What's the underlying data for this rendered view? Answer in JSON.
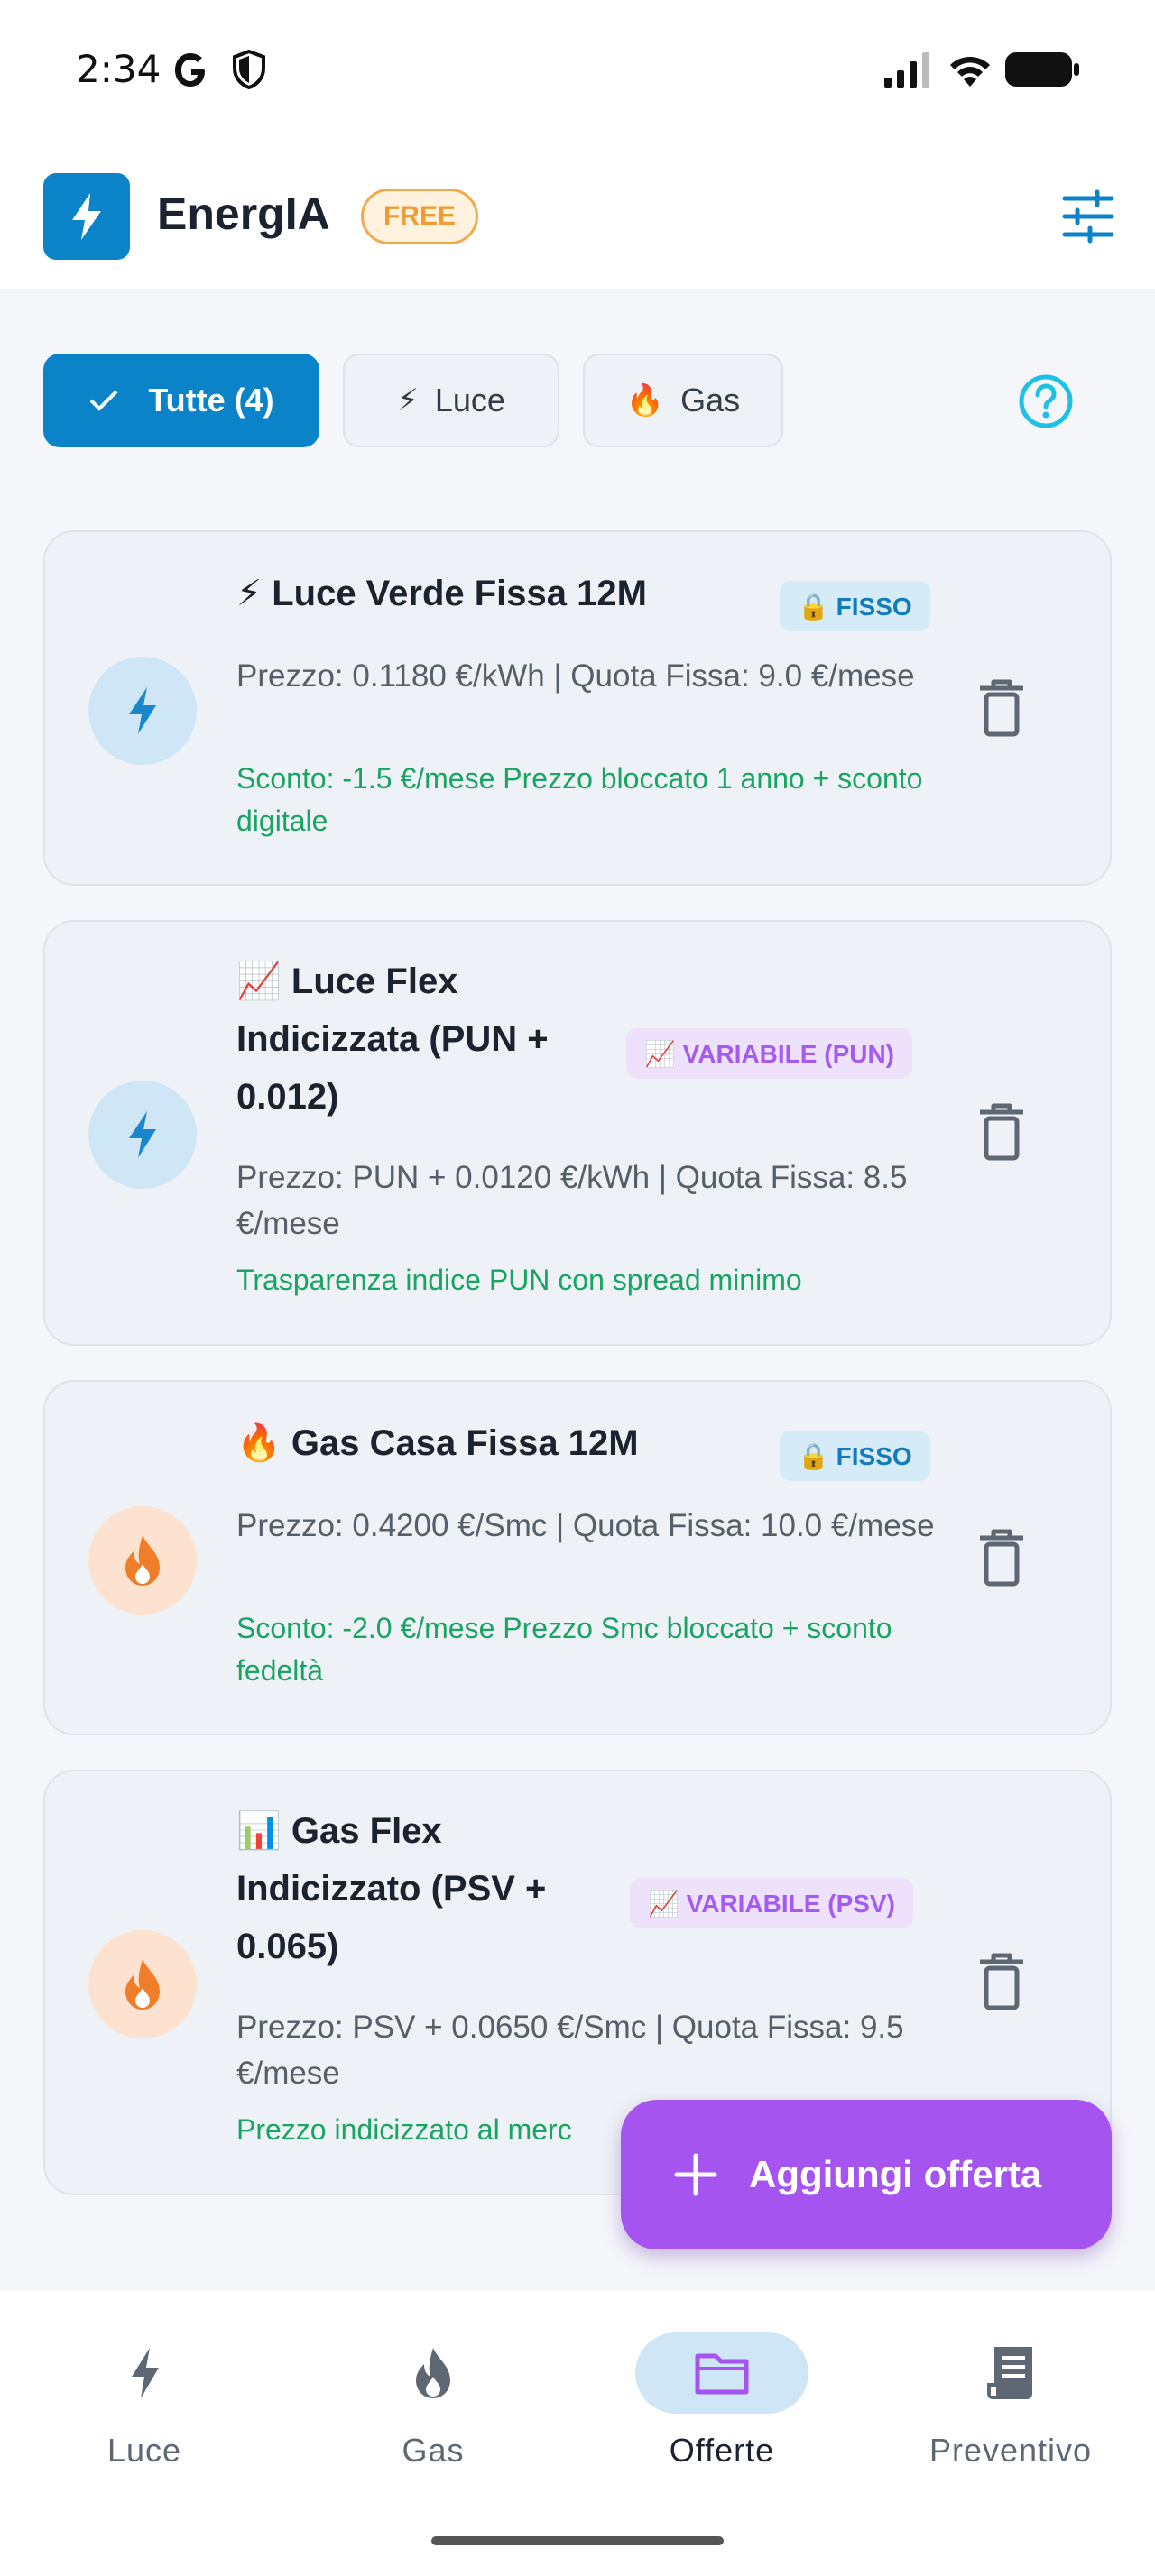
{
  "status_bar": {
    "time": "2:34"
  },
  "app_bar": {
    "title": "EnergIA",
    "plan_badge": "FREE"
  },
  "filters": [
    {
      "label": "Tutte (4)",
      "icon": "check-icon",
      "active": true
    },
    {
      "label": "Luce",
      "icon": "⚡",
      "active": false
    },
    {
      "label": "Gas",
      "icon": "🔥",
      "active": false
    }
  ],
  "offers": [
    {
      "type": "luce",
      "title": "⚡ Luce Verde Fissa 12M",
      "badge": "🔒 FISSO",
      "price": "Prezzo: 0.1180 €/kWh | Quota Fissa: 9.0 €/mese",
      "note": "Sconto: -1.5 €/mese Prezzo bloccato 1 anno + sconto digitale"
    },
    {
      "type": "luce",
      "title": "📈 Luce Flex Indicizzata (PUN + 0.012)",
      "badge": "📈 VARIABILE (PUN)",
      "price": "Prezzo: PUN + 0.0120 €/kWh | Quota Fissa: 8.5 €/mese",
      "note": "Trasparenza indice PUN con spread minimo"
    },
    {
      "type": "gas",
      "title": "🔥 Gas Casa Fissa 12M",
      "badge": "🔒 FISSO",
      "price": "Prezzo: 0.4200 €/Smc | Quota Fissa: 10.0 €/mese",
      "note": "Sconto: -2.0 €/mese Prezzo Smc bloccato + sconto fedeltà"
    },
    {
      "type": "gas",
      "title": "📊 Gas Flex Indicizzato (PSV + 0.065)",
      "badge": "📈 VARIABILE (PSV)",
      "price": "Prezzo: PSV + 0.0650 €/Smc | Quota Fissa: 9.5 €/mese",
      "note": "Prezzo indicizzato al merc"
    }
  ],
  "fab": {
    "label": "Aggiungi offerta"
  },
  "bottom_nav": [
    {
      "label": "Luce",
      "icon": "bolt-icon",
      "active": false
    },
    {
      "label": "Gas",
      "icon": "flame-icon",
      "active": false
    },
    {
      "label": "Offerte",
      "icon": "folder-icon",
      "active": true
    },
    {
      "label": "Preventivo",
      "icon": "receipt-icon",
      "active": false
    }
  ],
  "colors": {
    "primary": "#0b83c9",
    "accent": "#a654f0",
    "success_text": "#19a463",
    "free_badge": "#f09c35"
  }
}
